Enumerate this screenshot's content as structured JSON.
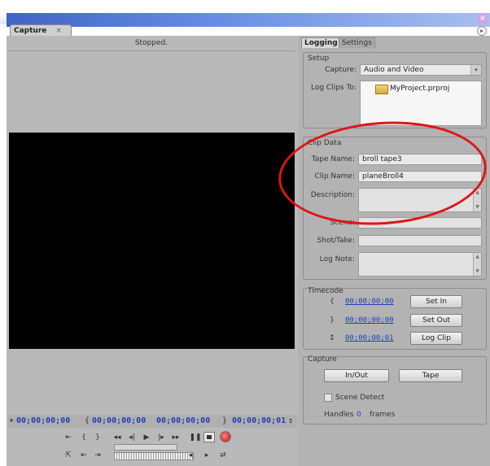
{
  "window": {
    "close_glyph": "×"
  },
  "panel": {
    "tab_label": "Capture",
    "tab_close": "×"
  },
  "monitor": {
    "status": "Stopped.",
    "timecodes": {
      "current": "00;00;00;00",
      "in": "00;00;00;00",
      "out": "00;00;00;00",
      "duration": "00;00;00;01"
    }
  },
  "tabs": [
    {
      "label": "Logging",
      "active": true
    },
    {
      "label": "Settings",
      "active": false
    }
  ],
  "setup": {
    "group_label": "Setup",
    "capture_label": "Capture:",
    "capture_value": "Audio and Video",
    "log_clips_label": "Log Clips To:",
    "log_clips_value": "MyProject.prproj"
  },
  "clip_data": {
    "group_label": "Clip Data",
    "tape_name_label": "Tape Name:",
    "tape_name_value": "broll tape3",
    "clip_name_label": "Clip Name:",
    "clip_name_value": "planeBroll4",
    "description_label": "Description:",
    "scene_label": "Scene:",
    "shot_take_label": "Shot/Take:",
    "log_note_label": "Log Note:"
  },
  "timecode": {
    "group_label": "Timecode",
    "in_value": "00;00;00;00",
    "out_value": "00;00;00;00",
    "duration_value": "00;00;00;01",
    "set_in_label": "Set In",
    "set_out_label": "Set Out",
    "log_clip_label": "Log Clip"
  },
  "capture": {
    "group_label": "Capture",
    "in_out_label": "In/Out",
    "tape_label": "Tape",
    "scene_detect_label": "Scene Detect",
    "handles_label": "Handles",
    "handles_value": "0",
    "frames_label": "frames"
  },
  "icons": {
    "folder": "folder-icon",
    "dropdown": "chevron-down-icon",
    "annotation": "red-oval-highlight"
  },
  "colors": {
    "timecode": "#1f3fb9",
    "annotation": "#e01515",
    "titlebar": "#3f64c7"
  }
}
